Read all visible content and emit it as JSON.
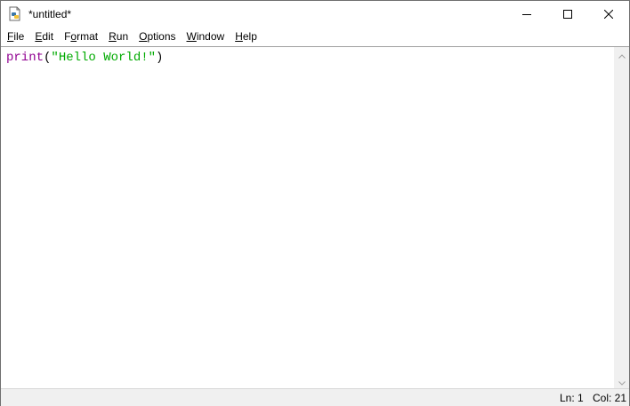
{
  "window": {
    "title": "*untitled*"
  },
  "icons": {
    "app": "python-idle-icon",
    "minimize": "minimize-icon",
    "maximize": "maximize-icon",
    "close": "close-icon",
    "scroll_up": "chevron-up-icon",
    "scroll_down": "chevron-down-icon"
  },
  "menu": {
    "items": [
      {
        "accel": "F",
        "rest": "ile"
      },
      {
        "accel": "E",
        "rest": "dit"
      },
      {
        "accel": "",
        "pre": "F",
        "accel2": "o",
        "rest": "rmat"
      },
      {
        "accel": "R",
        "rest": "un"
      },
      {
        "accel": "O",
        "rest": "ptions"
      },
      {
        "accel": "W",
        "rest": "indow"
      },
      {
        "accel": "H",
        "rest": "elp"
      }
    ]
  },
  "editor": {
    "code": {
      "builtin": "print",
      "open_paren": "(",
      "string": "\"Hello World!\"",
      "close_paren": ")"
    },
    "colors": {
      "builtin": "#900090",
      "string": "#00aa00",
      "default": "#000000"
    }
  },
  "status": {
    "line": "Ln: 1",
    "column": "Col: 21"
  }
}
